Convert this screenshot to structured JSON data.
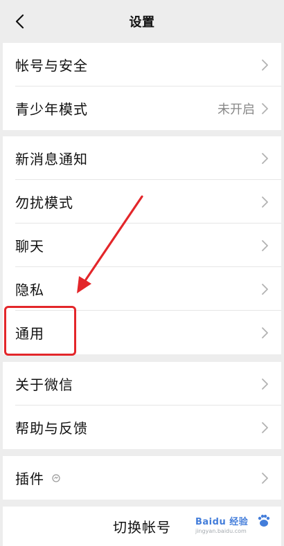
{
  "header": {
    "title": "设置"
  },
  "icons": {
    "back": "chevron-left-icon",
    "chevron": "chevron-right-icon",
    "plugin_badge": "plugin-status-icon"
  },
  "groups": [
    {
      "items": [
        {
          "label": "帐号与安全",
          "value": ""
        },
        {
          "label": "青少年模式",
          "value": "未开启"
        }
      ]
    },
    {
      "items": [
        {
          "label": "新消息通知",
          "value": ""
        },
        {
          "label": "勿扰模式",
          "value": ""
        },
        {
          "label": "聊天",
          "value": ""
        },
        {
          "label": "隐私",
          "value": ""
        },
        {
          "label": "通用",
          "value": ""
        }
      ]
    },
    {
      "items": [
        {
          "label": "关于微信",
          "value": ""
        },
        {
          "label": "帮助与反馈",
          "value": ""
        }
      ]
    },
    {
      "items": [
        {
          "label": "插件",
          "value": ""
        }
      ]
    }
  ],
  "footer": {
    "switch_account": "切换帐号"
  },
  "annotation": {
    "color": "#e3262a"
  },
  "watermark": {
    "name": "Baidu 经验",
    "url": "jingyan.baidu.com"
  }
}
